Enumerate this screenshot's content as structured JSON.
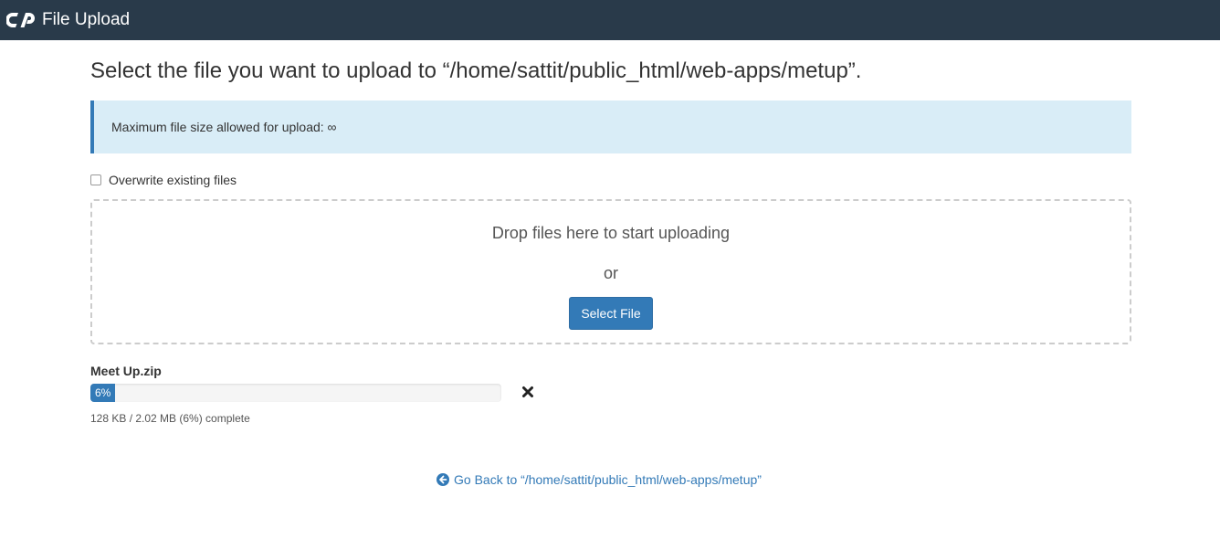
{
  "header": {
    "logo_icon": "cpanel-logo-icon",
    "title": "File Upload",
    "background_color": "#293a4a"
  },
  "page": {
    "heading": "Select the file you want to upload to “/home/sattit/public_html/web-apps/metup”."
  },
  "info": {
    "text": "Maximum file size allowed for upload: ∞"
  },
  "overwrite": {
    "label": "Overwrite existing files",
    "checked": false
  },
  "dropzone": {
    "prompt": "Drop files here to start uploading",
    "or_text": "or",
    "button_label": "Select File"
  },
  "upload": {
    "file_name": "Meet Up.zip",
    "progress_label": "6%",
    "progress_fraction": 0.06,
    "status": "128 KB / 2.02 MB (6%) complete",
    "cancel_icon": "close-icon"
  },
  "footer": {
    "back_icon": "arrow-circle-left-icon",
    "back_link": "Go Back to “/home/sattit/public_html/web-apps/metup”"
  },
  "colors": {
    "accent": "#337ab7",
    "info_bg": "#d9edf7"
  }
}
